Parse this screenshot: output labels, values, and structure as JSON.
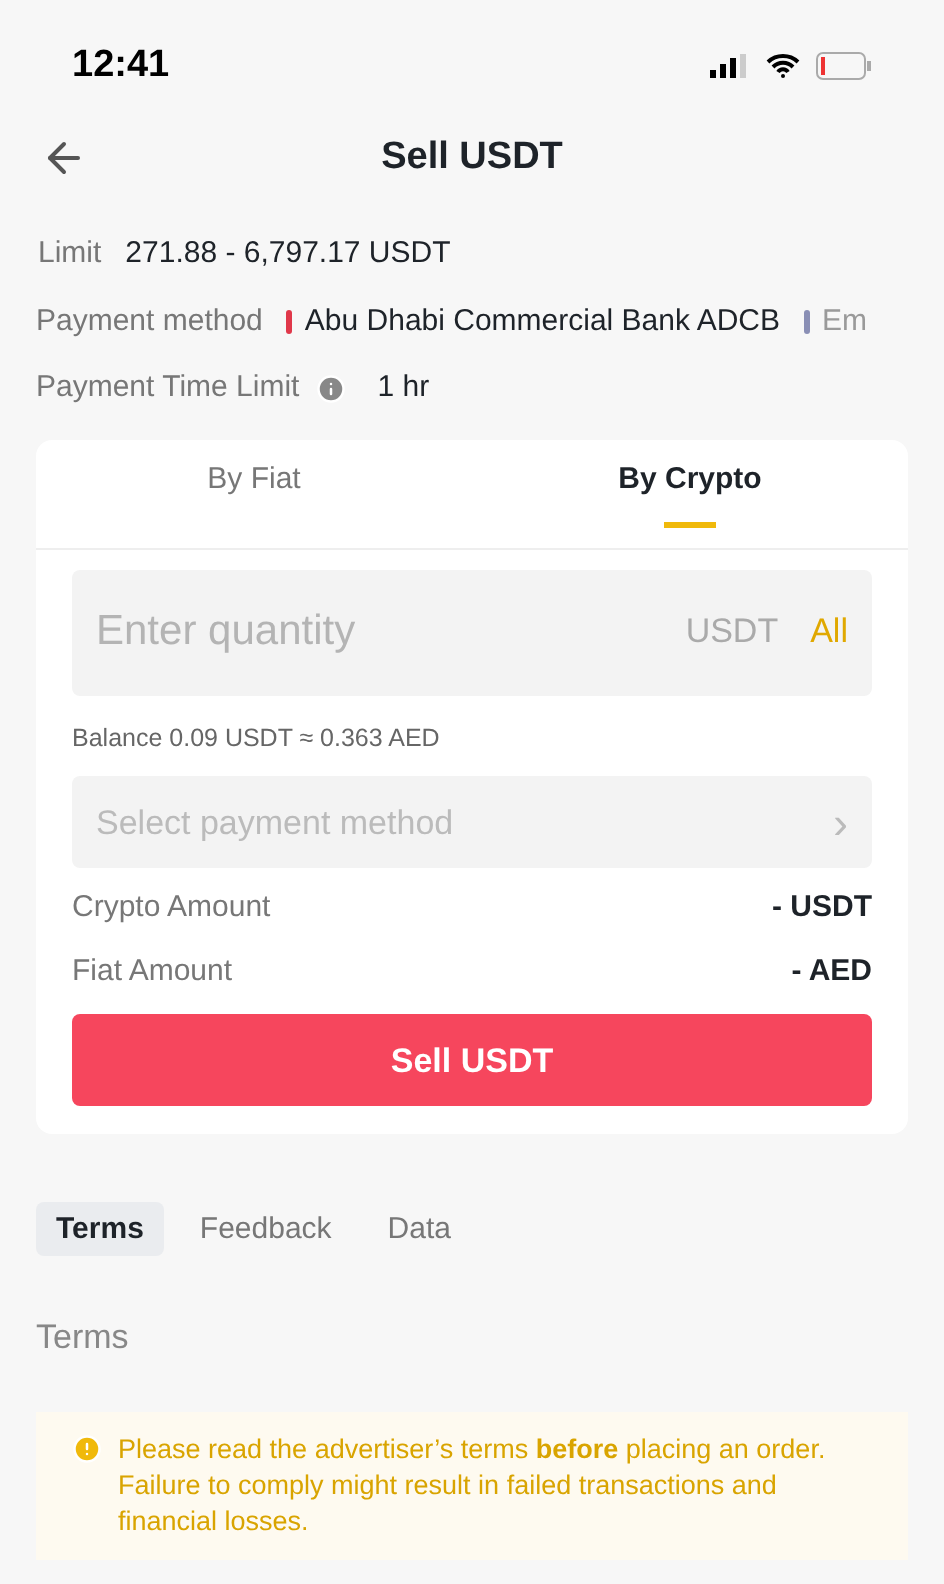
{
  "status_bar": {
    "time": "12:41"
  },
  "header": {
    "title": "Sell USDT"
  },
  "details": {
    "limit_label": "Limit",
    "limit_value": "271.88 - 6,797.17 USDT",
    "payment_label": "Payment method",
    "payment_methods": [
      {
        "name": "Abu Dhabi Commercial Bank ADCB",
        "color": "#e0384a"
      },
      {
        "name": "Em",
        "color": "#8a8fb5"
      }
    ],
    "time_label": "Payment Time Limit",
    "time_value": "1 hr"
  },
  "order_tabs": [
    {
      "label": "By Fiat",
      "selected": false
    },
    {
      "label": "By Crypto",
      "selected": true
    }
  ],
  "quantity": {
    "placeholder": "Enter quantity",
    "unit": "USDT",
    "all": "All"
  },
  "balance": "Balance 0.09 USDT ≈ 0.363 AED",
  "payment_select": {
    "placeholder": "Select payment method",
    "arrow": "›"
  },
  "amounts": [
    {
      "label": "Crypto Amount",
      "value": "- USDT"
    },
    {
      "label": "Fiat Amount",
      "value": "- AED"
    }
  ],
  "sell_button": "Sell USDT",
  "info_tabs": [
    {
      "label": "Terms",
      "selected": true
    },
    {
      "label": "Feedback",
      "selected": false
    },
    {
      "label": "Data",
      "selected": false
    }
  ],
  "section_title": "Terms",
  "notice": "Please read the advertiser’s terms **before** placing an order. Failure to comply might result in failed transactions and financial losses."
}
